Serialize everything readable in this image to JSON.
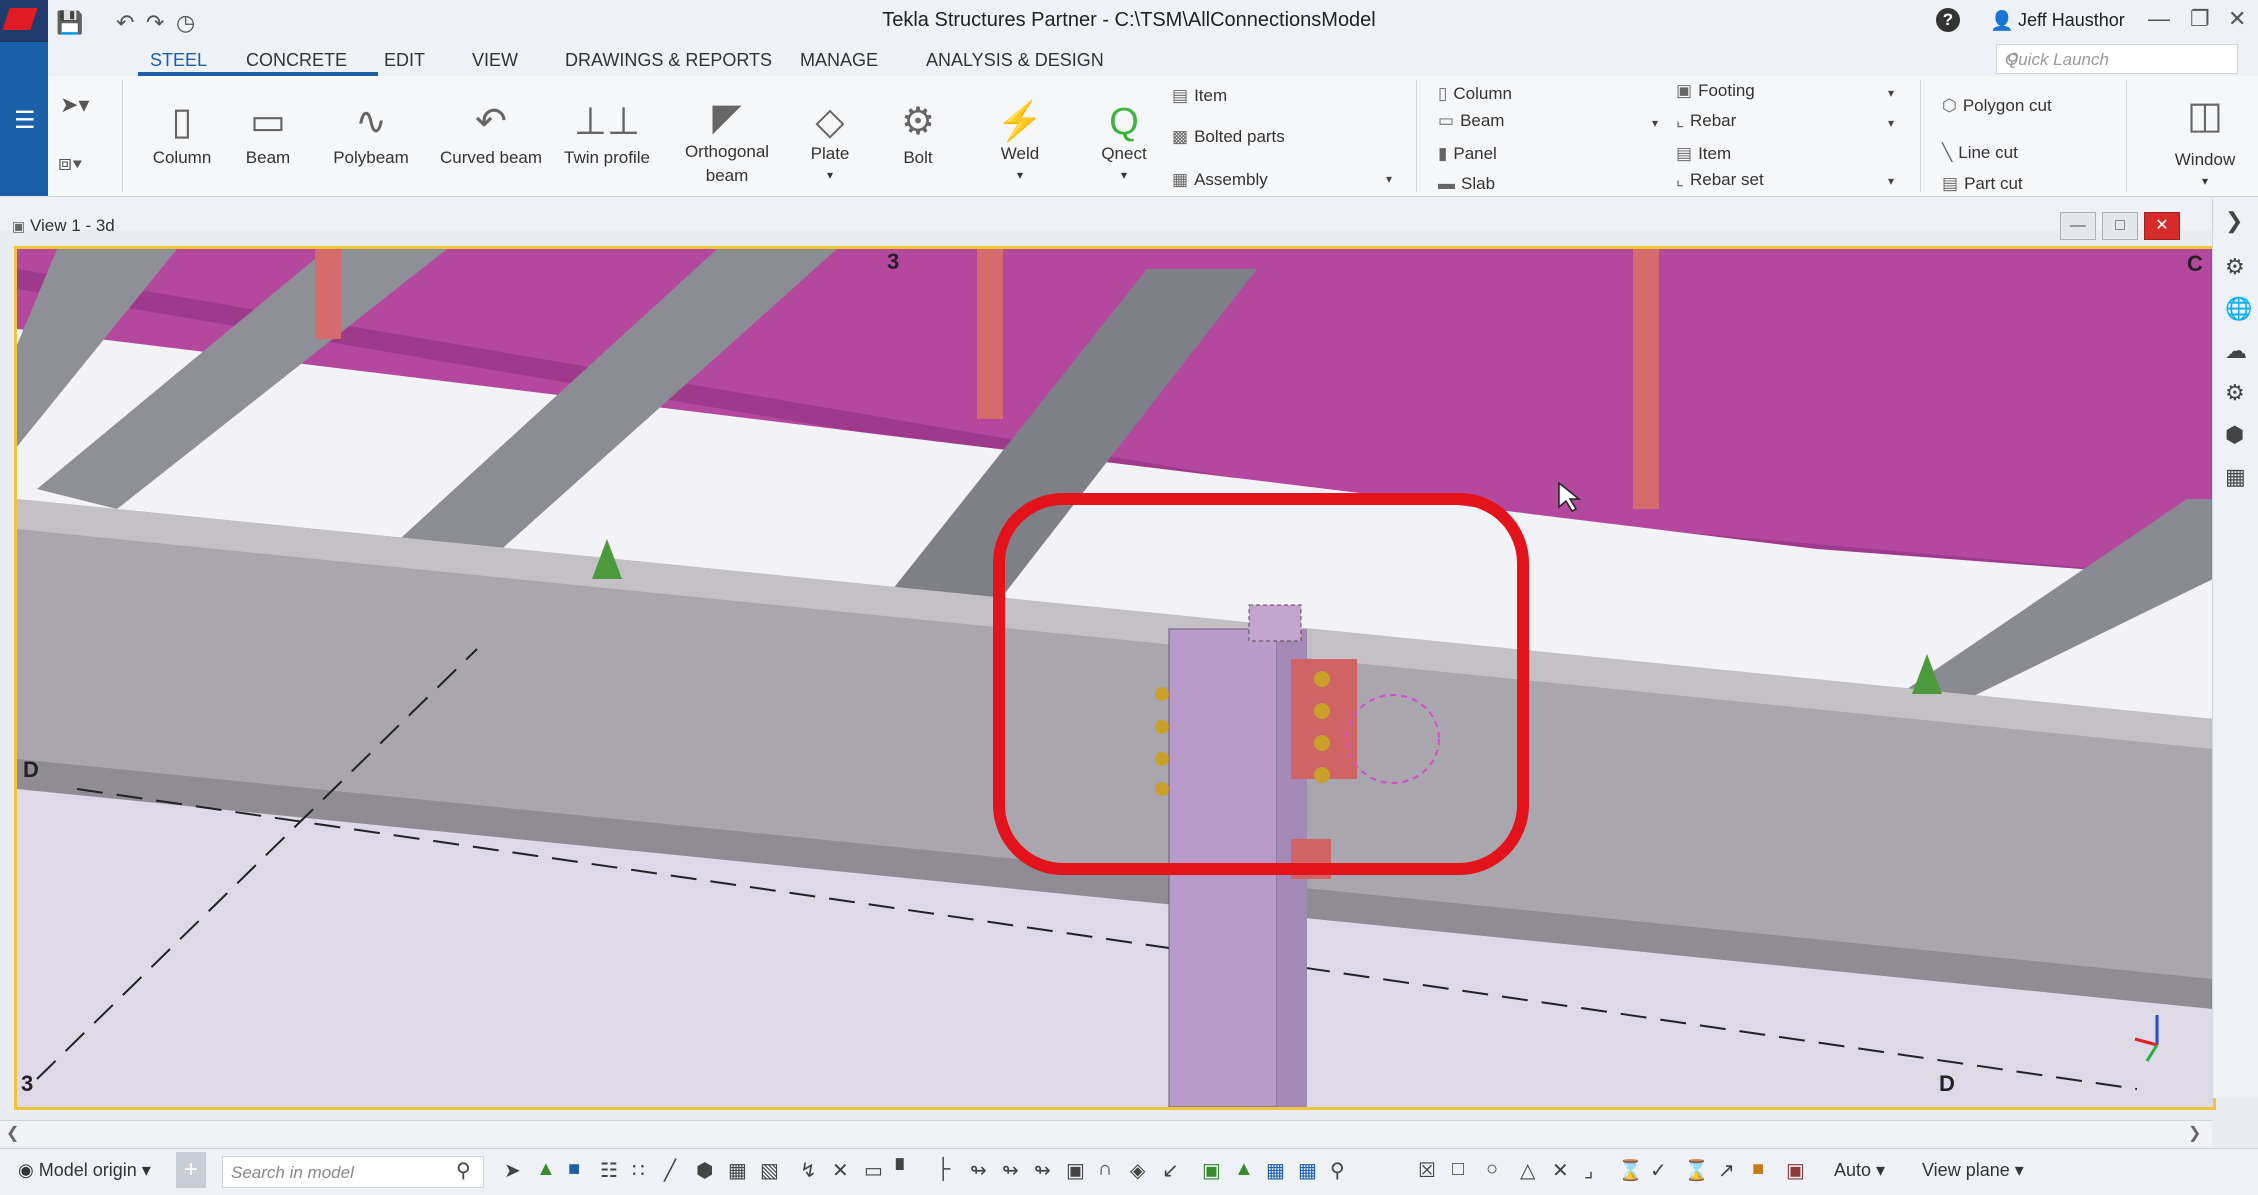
{
  "window": {
    "title": "Tekla Structures Partner - C:\\TSM\\AllConnectionsModel",
    "user": "Jeff Hausthor"
  },
  "tabs": [
    "STEEL",
    "CONCRETE",
    "EDIT",
    "VIEW",
    "DRAWINGS & REPORTS",
    "MANAGE",
    "ANALYSIS & DESIGN"
  ],
  "quick_launch": {
    "placeholder": "Quick Launch"
  },
  "ribbon": {
    "steel_buttons": [
      "Column",
      "Beam",
      "Polybeam",
      "Curved beam",
      "Twin profile",
      "Orthogonal beam",
      "Plate",
      "Bolt",
      "Weld",
      "Qnect"
    ],
    "steel_list": [
      "Item",
      "Bolted parts",
      "Assembly"
    ],
    "concrete_list_a": [
      "Column",
      "Beam",
      "Panel",
      "Slab"
    ],
    "concrete_list_b": [
      "Footing",
      "Rebar",
      "Item",
      "Rebar set"
    ],
    "cut_list": [
      "Polygon cut",
      "Line cut",
      "Part cut"
    ],
    "window_label": "Window"
  },
  "view": {
    "title": "View 1 - 3d",
    "grid_labels": {
      "top3": "3",
      "topC": "C",
      "leftD": "D",
      "bottom3": "3",
      "bottomD": "D"
    }
  },
  "statusbar": {
    "model_origin": "Model origin",
    "search_placeholder": "Search in model",
    "auto": "Auto",
    "view_plane": "View plane"
  },
  "colors": {
    "accent": "#1b5fa8",
    "roof": "#b4479e",
    "highlight": "#e3131b",
    "frame": "#f2c43a"
  }
}
